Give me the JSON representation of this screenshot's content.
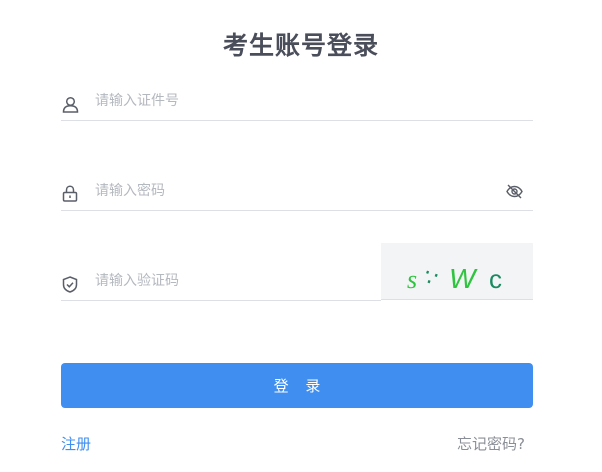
{
  "title": "考生账号登录",
  "form": {
    "id_placeholder": "请输入证件号",
    "id_value": "",
    "password_placeholder": "请输入密码",
    "password_value": "",
    "captcha_placeholder": "请输入验证码",
    "captcha_value": ""
  },
  "captcha_image": {
    "chars": [
      "s",
      "∵",
      "W",
      "c"
    ],
    "background": "#f2f4f5"
  },
  "buttons": {
    "login_label": "登 录"
  },
  "links": {
    "register": "注册",
    "forgot_password": "忘记密码?"
  },
  "icons": {
    "id_field": "user-icon",
    "password_field": "lock-icon",
    "password_toggle": "eye-off-icon",
    "captcha_field": "shield-check-icon"
  },
  "colors": {
    "primary": "#3f8ef0",
    "title": "#4a4e5a",
    "placeholder": "#b4b8bf",
    "muted_link": "#8a8e96",
    "captcha_green": "#2fc43f",
    "captcha_teal": "#1a8a60"
  }
}
